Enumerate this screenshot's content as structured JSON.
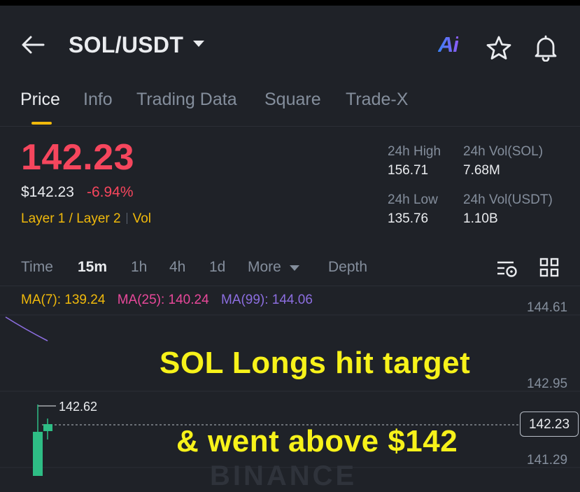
{
  "header": {
    "pair": "SOL/USDT",
    "ai_label": "Ai"
  },
  "tabs": [
    "Price",
    "Info",
    "Trading Data",
    "Square",
    "Trade-X"
  ],
  "price": {
    "last": "142.23",
    "usd": "$142.23",
    "change": "-6.94%",
    "tag1": "Layer 1 / Layer 2",
    "tag2": "Vol"
  },
  "stats": {
    "high_label": "24h High",
    "high_value": "156.71",
    "vol_sol_label": "24h Vol(SOL)",
    "vol_sol_value": "7.68M",
    "low_label": "24h Low",
    "low_value": "135.76",
    "vol_usdt_label": "24h Vol(USDT)",
    "vol_usdt_value": "1.10B"
  },
  "intervals": {
    "time": "Time",
    "m15": "15m",
    "h1": "1h",
    "h4": "4h",
    "d1": "1d",
    "more": "More",
    "depth": "Depth"
  },
  "chart": {
    "ma7": "MA(7): 139.24",
    "ma25": "MA(25): 140.24",
    "ma99": "MA(99): 144.06",
    "axis": [
      "144.61",
      "142.95",
      "141.29"
    ],
    "high_marker": "142.62",
    "current_price": "142.23",
    "watermark": "BINANCE",
    "colors": {
      "up": "#2ebd85",
      "down": "#f6465d",
      "ma99": "#8c6ee0"
    }
  },
  "overlay": {
    "line1": "SOL Longs hit target",
    "line2": "& went above $142"
  }
}
